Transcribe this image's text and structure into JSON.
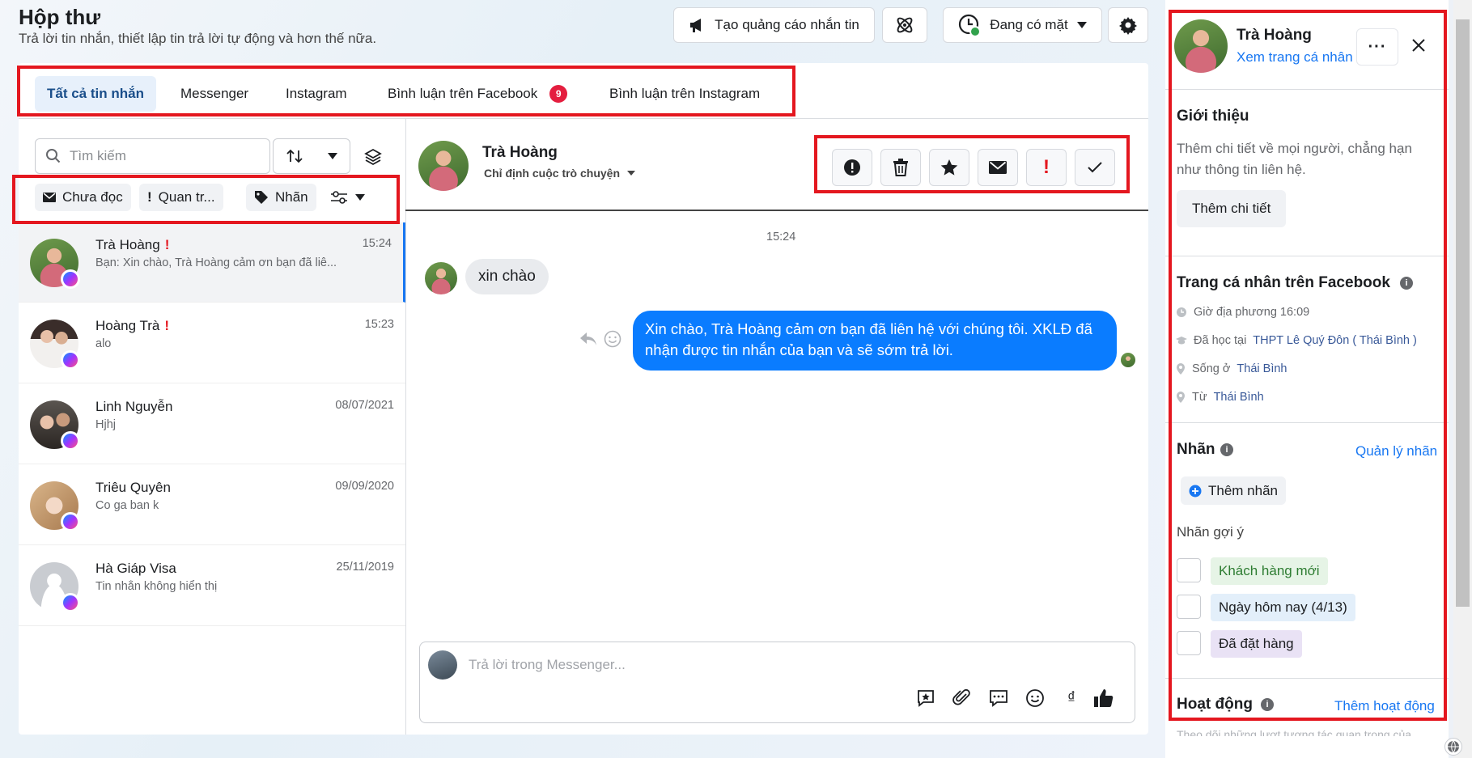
{
  "header": {
    "title": "Hộp thư",
    "subtitle": "Trả lời tin nhắn, thiết lập tin trả lời tự động và hơn thế nữa.",
    "ad_button": "Tạo quảng cáo nhắn tin",
    "status_button": "Đang có mặt"
  },
  "tabs": [
    {
      "label": "Tất cả tin nhắn"
    },
    {
      "label": "Messenger"
    },
    {
      "label": "Instagram"
    },
    {
      "label": "Bình luận trên Facebook",
      "badge": "9"
    },
    {
      "label": "Bình luận trên Instagram"
    }
  ],
  "search": {
    "placeholder": "Tìm kiếm"
  },
  "filters": {
    "unread": "Chưa đọc",
    "important": "Quan tr...",
    "labels": "Nhãn"
  },
  "conversations": [
    {
      "name": "Trà Hoàng",
      "important": true,
      "time": "15:24",
      "preview": "Bạn: Xin chào, Trà Hoàng cảm ơn bạn đã liê..."
    },
    {
      "name": "Hoàng Trà",
      "important": true,
      "time": "15:23",
      "preview": "alo"
    },
    {
      "name": "Linh Nguyễn",
      "important": false,
      "time": "08/07/2021",
      "preview": "Hjhj"
    },
    {
      "name": "Triêu Quyên",
      "important": false,
      "time": "09/09/2020",
      "preview": "Co ga ban k"
    },
    {
      "name": "Hà Giáp Visa",
      "important": false,
      "time": "25/11/2019",
      "preview": "Tin nhắn không hiển thị"
    }
  ],
  "chat": {
    "name": "Trà Hoàng",
    "assign": "Chỉ định cuộc trò chuyện",
    "timestamp": "15:24",
    "incoming": "xin chào",
    "outgoing": "Xin chào, Trà Hoàng  cảm ơn bạn đã liên hệ với chúng tôi. XKLĐ đã nhận được tin nhắn của bạn và sẽ sớm trả lời.",
    "reply_placeholder": "Trả lời trong Messenger..."
  },
  "profile": {
    "name": "Trà Hoàng",
    "view_profile": "Xem trang cá nhân",
    "intro_title": "Giới thiệu",
    "intro_text": "Thêm chi tiết về mọi người, chẳng hạn như thông tin liên hệ.",
    "add_details": "Thêm chi tiết",
    "fb_title": "Trang cá nhân trên Facebook",
    "local_time": "Giờ địa phương 16:09",
    "studied_prefix": "Đã học tại",
    "studied_at": "THPT Lê Quý Đôn ( Thái Bình )",
    "lives_prefix": "Sống ở",
    "lives_in": "Thái Bình",
    "from_prefix": "Từ",
    "from": "Thái Bình",
    "labels_title": "Nhãn",
    "manage_labels": "Quản lý nhãn",
    "add_label": "Thêm nhãn",
    "suggested_title": "Nhãn gợi ý",
    "suggested": [
      {
        "label": "Khách hàng mới",
        "bg": "#e6f4e6",
        "fg": "#2e7d32"
      },
      {
        "label": "Ngày hôm nay (4/13)",
        "bg": "#e3effa",
        "fg": "#1c1e21"
      },
      {
        "label": "Đã đặt hàng",
        "bg": "#e9e2f5",
        "fg": "#1c1e21"
      }
    ],
    "activity_title": "Hoạt động",
    "add_activity": "Thêm hoạt động",
    "activity_text": "Theo dõi những lượt tương tác quan trọng của"
  },
  "colors": {
    "accent": "#1877f2",
    "highlight_border": "#e4171f",
    "bubble_out": "#0a7cff"
  }
}
